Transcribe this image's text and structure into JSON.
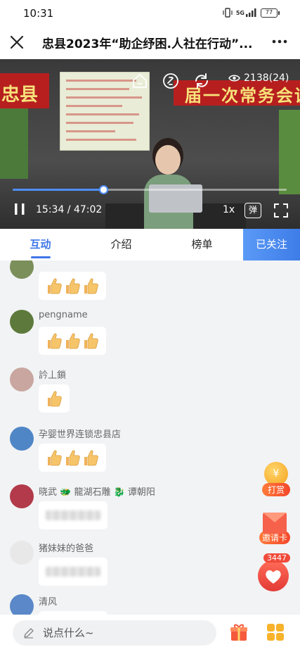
{
  "status_bar": {
    "time": "10:31",
    "network": "5G",
    "battery": "77"
  },
  "header": {
    "title": "忠县2023年“助企纾困.人社在行动”..."
  },
  "video": {
    "banner_left": "忠县",
    "banner_right": "届一次常务会议",
    "viewer_count": "2138(24)",
    "current_time": "15:34",
    "total_time": "47:02",
    "time_separator": " / ",
    "progress": 0.33,
    "speed": "1x",
    "danmu_label": "弹"
  },
  "tabs": [
    {
      "label": "互动",
      "active": true
    },
    {
      "label": "介绍",
      "active": false
    },
    {
      "label": "榜单",
      "active": false
    }
  ],
  "follow_label": "已关注",
  "comments": [
    {
      "name": "",
      "thumbs": 3,
      "avatar_color": "#7a8f5a"
    },
    {
      "name": "pengname",
      "thumbs": 3,
      "avatar_color": "#5d7a3c"
    },
    {
      "name": "訡丄鎖",
      "thumbs": 1,
      "avatar_color": "#c9a6a0"
    },
    {
      "name": "孕婴世界连锁忠县店",
      "thumbs": 3,
      "avatar_color": "#4f86c6"
    },
    {
      "name": "晓武 🐲 龍湖石雕 🐉 谭朝阳",
      "thumbs": 0,
      "avatar_color": "#b23a4a"
    },
    {
      "name": "猪妹妹的爸爸",
      "thumbs": 0,
      "avatar_color": "#e8e8e8"
    },
    {
      "name": "清风",
      "thumbs": 0,
      "avatar_color": "#5a88c8"
    }
  ],
  "floating": {
    "reward_label": "打赏",
    "reward_coin": "¥",
    "invite_label": "邀请卡",
    "like_count": "3447"
  },
  "input": {
    "placeholder": "说点什么~"
  },
  "colors": {
    "accent": "#3f76e8",
    "follow_bg": "#4a8af0",
    "reward": "#f4472b"
  }
}
